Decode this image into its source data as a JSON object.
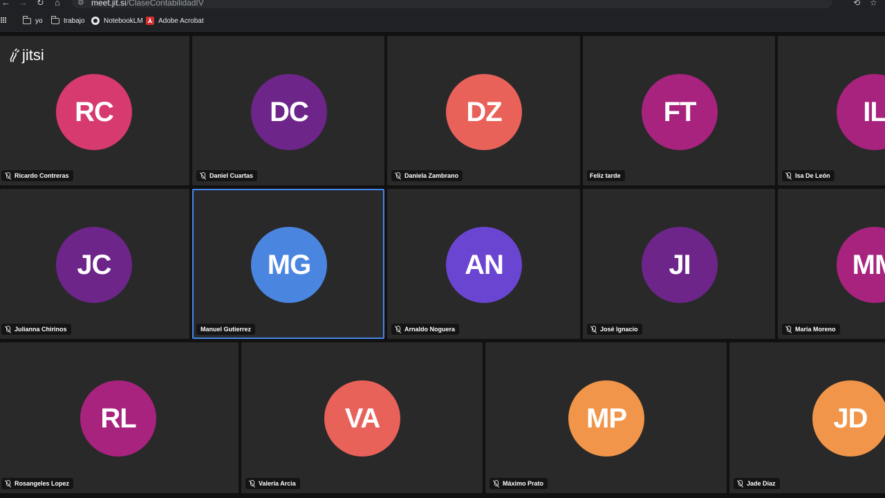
{
  "browser": {
    "url_host": "meet.jit.si",
    "url_path": "/ClaseContabilidadIV",
    "bookmarks": [
      {
        "label": "yo",
        "icon": "folder-icon"
      },
      {
        "label": "trabajo",
        "icon": "folder-icon"
      },
      {
        "label": "NotebookLM",
        "icon": "notebooklm-icon"
      },
      {
        "label": "Adobe Acrobat",
        "icon": "acrobat-icon"
      }
    ]
  },
  "meeting": {
    "logo": "jitsi",
    "participants": [
      {
        "initials": "RC",
        "name": "Ricardo Contreras",
        "color": "#d63a6e",
        "muted": true
      },
      {
        "initials": "DC",
        "name": "Daniel Cuartas",
        "color": "#6d258a",
        "muted": true
      },
      {
        "initials": "DZ",
        "name": "Daniela Zambrano",
        "color": "#e8625a",
        "muted": true
      },
      {
        "initials": "FT",
        "name": "Feliz tarde",
        "color": "#a8237e",
        "muted": false
      },
      {
        "initials": "IL",
        "name": "Isa De León",
        "color": "#a8237e",
        "muted": true
      },
      {
        "initials": "JC",
        "name": "Julianna Chirinos",
        "color": "#6d258a",
        "muted": true
      },
      {
        "initials": "MG",
        "name": "Manuel Gutierrez",
        "color": "#4a86e0",
        "muted": false,
        "active": true
      },
      {
        "initials": "AN",
        "name": "Arnaldo Noguera",
        "color": "#6a45d1",
        "muted": true
      },
      {
        "initials": "JI",
        "name": "José Ignacio",
        "color": "#6d258a",
        "muted": true
      },
      {
        "initials": "MM",
        "name": "Maria Moreno",
        "color": "#a8237e",
        "muted": true
      },
      {
        "initials": "RL",
        "name": "Rosangeles Lopez",
        "color": "#a8237e",
        "muted": true
      },
      {
        "initials": "VA",
        "name": "Valeria Arcia",
        "color": "#e8625a",
        "muted": true
      },
      {
        "initials": "MP",
        "name": "Máximo Prato",
        "color": "#f0954a",
        "muted": true
      },
      {
        "initials": "JD",
        "name": "Jade Díaz",
        "color": "#f0954a",
        "muted": true
      }
    ]
  }
}
